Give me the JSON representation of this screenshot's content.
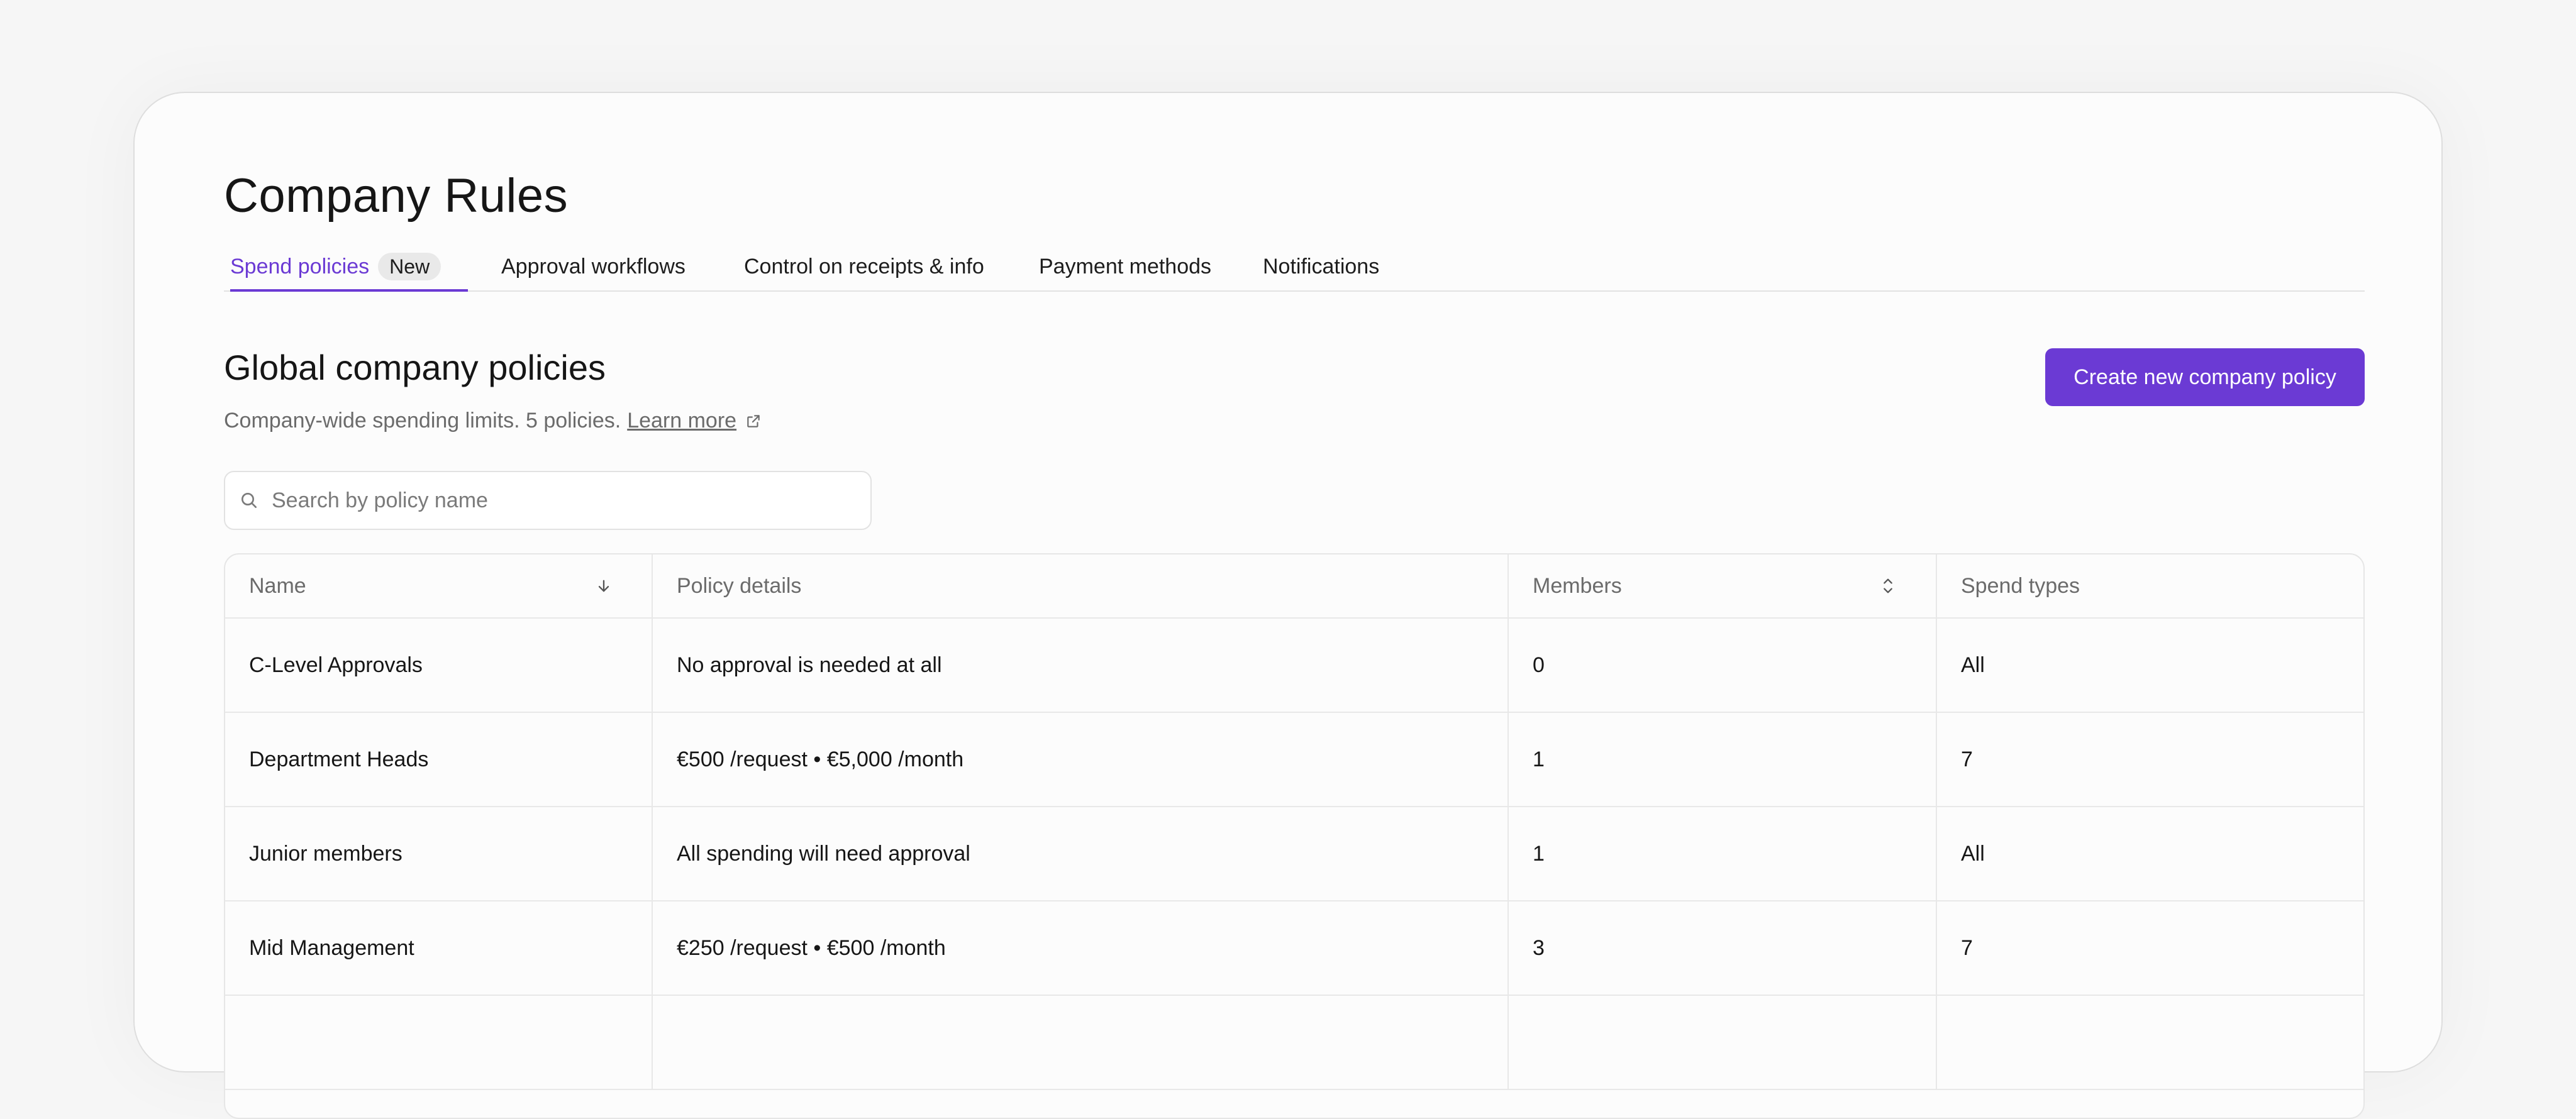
{
  "page": {
    "title": "Company Rules"
  },
  "tabs": [
    {
      "label": "Spend policies",
      "badge": "New",
      "active": true
    },
    {
      "label": "Approval workflows"
    },
    {
      "label": "Control on receipts & info"
    },
    {
      "label": "Payment methods"
    },
    {
      "label": "Notifications"
    }
  ],
  "section": {
    "title": "Global company policies",
    "subtitle": "Company-wide spending limits. 5 policies.",
    "learn_more": "Learn more",
    "create_button": "Create new company policy"
  },
  "search": {
    "placeholder": "Search by policy name"
  },
  "table": {
    "columns": [
      "Name",
      "Policy details",
      "Members",
      "Spend types"
    ],
    "rows": [
      {
        "name": "C-Level Approvals",
        "details": "No approval is needed at all",
        "members": "0",
        "spend_types": "All"
      },
      {
        "name": "Department Heads",
        "details": "€500 /request • €5,000 /month",
        "members": "1",
        "spend_types": "7"
      },
      {
        "name": "Junior members",
        "details": "All spending will need approval",
        "members": "1",
        "spend_types": "All"
      },
      {
        "name": "Mid Management",
        "details": "€250 /request • €500 /month",
        "members": "3",
        "spend_types": "7"
      },
      {
        "name": "",
        "details": "",
        "members": "",
        "spend_types": ""
      }
    ]
  },
  "icons": {
    "search": "search-icon",
    "external_link": "external-link-icon",
    "sort_desc": "arrow-down-icon",
    "sort_toggle": "chevron-up-down-icon"
  },
  "colors": {
    "accent": "#6b3ad4",
    "badge_bg": "#e9e9e9"
  }
}
